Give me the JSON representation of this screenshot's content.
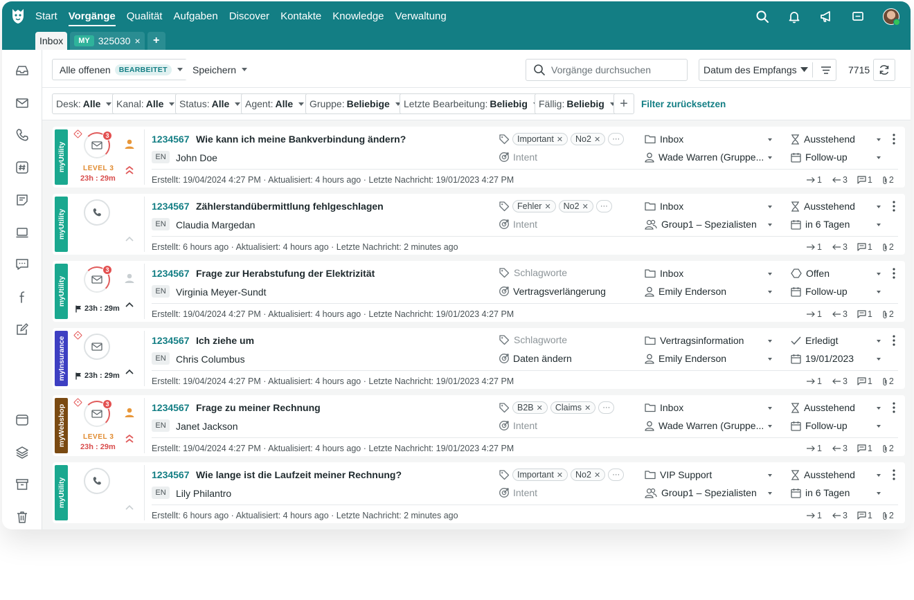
{
  "nav": {
    "items": [
      "Start",
      "Vorgänge",
      "Qualität",
      "Aufgaben",
      "Discover",
      "Kontakte",
      "Knowledge",
      "Verwaltung"
    ],
    "active": "Vorgänge"
  },
  "tabs": {
    "inbox": "Inbox",
    "my_badge": "MY",
    "ticket_tab": "325030",
    "close": "×",
    "add": "+"
  },
  "toolbar": {
    "view": "Alle offenen",
    "view_badge": "BEARBEITET",
    "save": "Speichern",
    "search_placeholder": "Vorgänge durchsuchen",
    "sort": "Datum des Empfangs",
    "count": "7715"
  },
  "filters": {
    "desk": {
      "label": "Desk:",
      "value": "Alle"
    },
    "kanal": {
      "label": "Kanal:",
      "value": "Alle"
    },
    "status": {
      "label": "Status:",
      "value": "Alle"
    },
    "agent": {
      "label": "Agent:",
      "value": "Alle"
    },
    "gruppe": {
      "label": "Gruppe:",
      "value": "Beliebige"
    },
    "letzte": {
      "label": "Letzte Bearbeitung:",
      "value": "Beliebig"
    },
    "faellig": {
      "label": "Fällig:",
      "value": "Beliebig"
    },
    "add": "+",
    "reset": "Filter zurücksetzen"
  },
  "colors": {
    "brand": "#137e84",
    "myUtility": "#1aa88f",
    "myInsurance": "#3d3fc2",
    "myWebshop": "#7a4a12",
    "alert": "#e35050"
  },
  "rows": [
    {
      "brand": "myUtility",
      "channel": "envelope-icon",
      "badge": "3",
      "level": "LEVEL 3",
      "sla": "23h : 29m",
      "id": "1234567",
      "subject": "Wie kann ich meine Bankverbindung ändern?",
      "lang": "EN",
      "contact": "John Doe",
      "tags": [
        "Important",
        "No2"
      ],
      "more": "···",
      "intent": "Intent",
      "folder": "Inbox",
      "assignee": "Wade Warren (Gruppe...",
      "status": "Ausstehend",
      "due": "Follow-up",
      "meta": "Erstellt: 19/04/2024 4:27 PM · Aktualisiert: 4 hours ago · Letzte Nachricht: 19/01/2023 4:27 PM",
      "out": "1",
      "in": "3",
      "notes": "1",
      "att": "2"
    },
    {
      "brand": "myUtility",
      "channel": "phone-icon",
      "id": "1234567",
      "subject": "Zählerstandübermittlung fehlgeschlagen",
      "lang": "EN",
      "contact": "Claudia Margedan",
      "tags": [
        "Fehler",
        "No2"
      ],
      "more": "···",
      "intent": "Intent",
      "folder": "Inbox",
      "assignee": "Group1 – Spezialisten",
      "status": "Ausstehend",
      "due": "in 6 Tagen",
      "meta": "Erstellt: 6 hours ago · Aktualisiert: 4 hours ago · Letzte Nachricht: 2 minutes ago",
      "out": "1",
      "in": "3",
      "notes": "1",
      "att": "2"
    },
    {
      "brand": "myUtility",
      "channel": "envelope-icon",
      "badge": "3",
      "sla": "23h : 29m",
      "id": "1234567",
      "subject": "Frage zur Herabstufung der Elektrizität",
      "lang": "EN",
      "contact": "Virginia Meyer-Sundt",
      "tag_placeholder": "Schlagworte",
      "intent": "Vertragsverlängerung",
      "folder": "Inbox",
      "assignee": "Emily Enderson",
      "status": "Offen",
      "due": "Follow-up",
      "meta": "Erstellt: 19/04/2024 4:27 PM · Aktualisiert: 4 hours ago · Letzte Nachricht: 19/01/2023 4:27 PM",
      "out": "1",
      "in": "3",
      "notes": "1",
      "att": "2"
    },
    {
      "brand": "myInsurance",
      "channel": "envelope-icon",
      "sla": "23h : 29m",
      "id": "1234567",
      "subject": "Ich ziehe um",
      "lang": "EN",
      "contact": "Chris Columbus",
      "tag_placeholder": "Schlagworte",
      "intent": "Daten ändern",
      "folder": "Vertragsinformation",
      "assignee": "Emily Enderson",
      "status": "Erledigt",
      "due": "19/01/2023",
      "meta": "Erstellt: 19/04/2024 4:27 PM · Aktualisiert: 4 hours ago · Letzte Nachricht: 19/01/2023 4:27 PM",
      "out": "1",
      "in": "3",
      "notes": "1",
      "att": "2"
    },
    {
      "brand": "myWebshop",
      "channel": "envelope-icon",
      "badge": "3",
      "level": "LEVEL 3",
      "sla": "23h : 29m",
      "id": "1234567",
      "subject": "Frage zu meiner Rechnung",
      "lang": "EN",
      "contact": "Janet Jackson",
      "tags": [
        "B2B",
        "Claims"
      ],
      "more": "···",
      "intent": "Intent",
      "folder": "Inbox",
      "assignee": "Wade Warren (Gruppe...",
      "status": "Ausstehend",
      "due": "Follow-up",
      "meta": "Erstellt: 19/04/2024 4:27 PM · Aktualisiert: 4 hours ago · Letzte Nachricht: 19/01/2023 4:27 PM",
      "out": "1",
      "in": "3",
      "notes": "1",
      "att": "2"
    },
    {
      "brand": "myUtility",
      "channel": "phone-icon",
      "id": "1234567",
      "subject": "Wie lange ist die Laufzeit meiner Rechnung?",
      "lang": "EN",
      "contact": "Lily Philantro",
      "tags": [
        "Important",
        "No2"
      ],
      "more": "···",
      "intent": "Intent",
      "folder": "VIP Support",
      "assignee": "Group1 – Spezialisten",
      "status": "Ausstehend",
      "due": "in 6 Tagen",
      "meta": "Erstellt: 6 hours ago · Aktualisiert: 4 hours ago · Letzte Nachricht: 2 minutes ago",
      "out": "1",
      "in": "3",
      "notes": "1",
      "att": "2"
    }
  ]
}
